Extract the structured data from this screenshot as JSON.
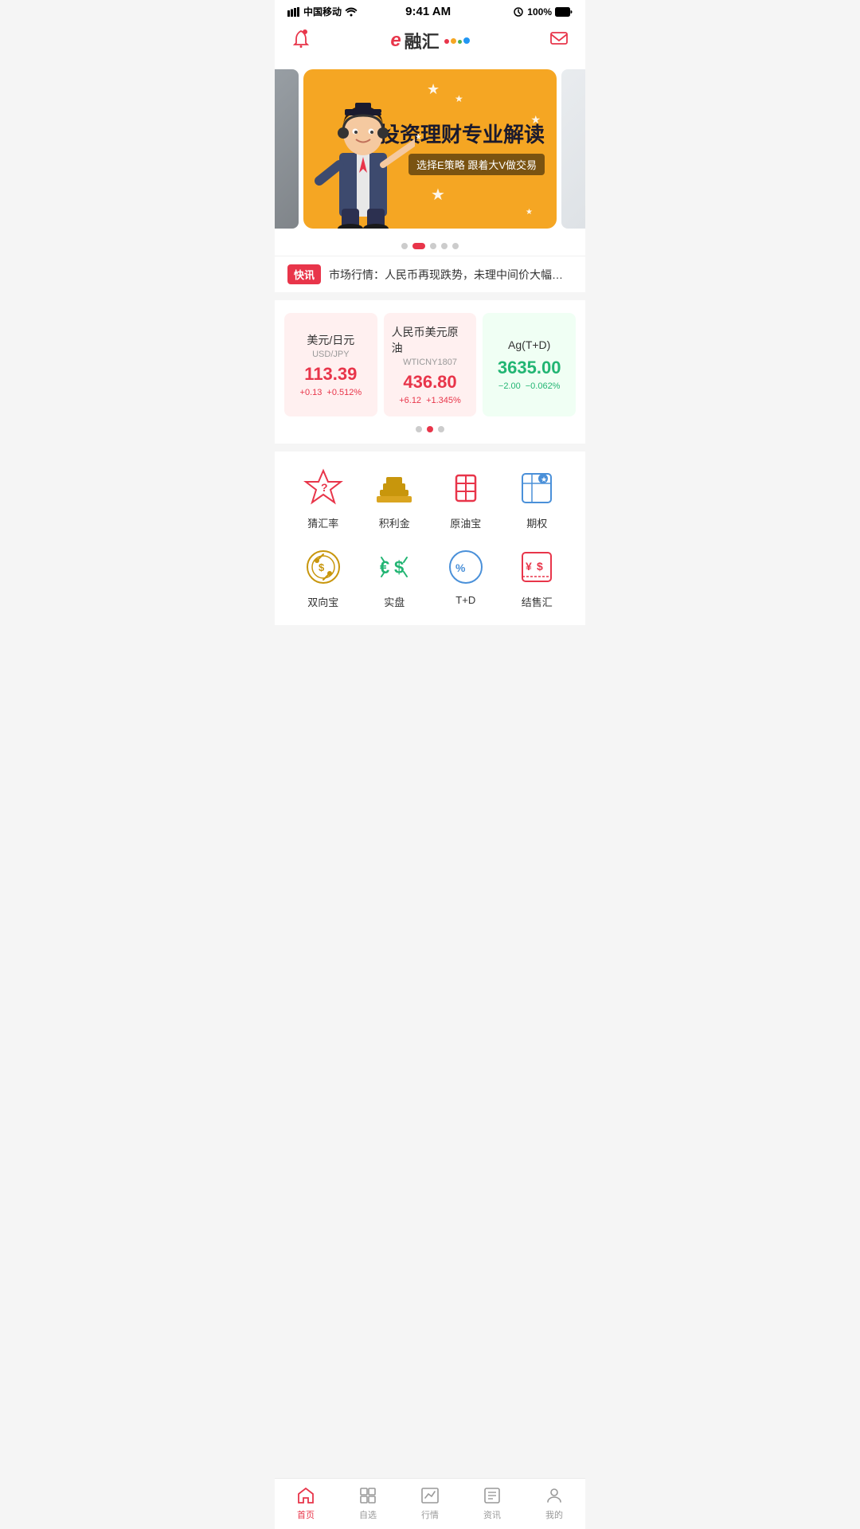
{
  "statusBar": {
    "carrier": "中国移动",
    "time": "9:41 AM",
    "battery": "100%"
  },
  "header": {
    "logoE": "e",
    "logoText": "融汇",
    "dotColors": [
      "#e8354a",
      "#f5a623",
      "#4caf50",
      "#2196f3"
    ]
  },
  "banner": {
    "title": "投资理财专业解读",
    "subtitle": "选择E策略 跟着大V做交易",
    "dots": [
      false,
      true,
      false,
      false,
      false
    ]
  },
  "newsTicker": {
    "badge": "快讯",
    "text": "市场行情：人民币再现跌势，未理中间价大幅上调到..."
  },
  "market": {
    "cards": [
      {
        "name": "美元/日元",
        "code": "USD/JPY",
        "price": "113.39",
        "change1": "+0.13",
        "change2": "+0.512%",
        "type": "up"
      },
      {
        "name": "人民币美元原油",
        "code": "WTICNY1807",
        "price": "436.80",
        "change1": "+6.12",
        "change2": "+1.345%",
        "type": "up"
      },
      {
        "name": "Ag(T+D)",
        "code": "",
        "price": "3635.00",
        "change1": "−2.00",
        "change2": "−0.062%",
        "type": "down"
      }
    ],
    "dots": [
      false,
      true,
      false
    ]
  },
  "menu": {
    "items": [
      {
        "id": "guess-rate",
        "label": "猜汇率",
        "color": "#e8354a"
      },
      {
        "id": "gold",
        "label": "积利金",
        "color": "#c8960c"
      },
      {
        "id": "crude-oil",
        "label": "原油宝",
        "color": "#e8354a"
      },
      {
        "id": "options",
        "label": "期权",
        "color": "#4a90d9"
      },
      {
        "id": "dual",
        "label": "双向宝",
        "color": "#c8960c"
      },
      {
        "id": "live",
        "label": "实盘",
        "color": "#22b573"
      },
      {
        "id": "td",
        "label": "T+D",
        "color": "#4a90d9"
      },
      {
        "id": "exchange",
        "label": "结售汇",
        "color": "#e8354a"
      }
    ]
  },
  "bottomNav": {
    "items": [
      {
        "id": "home",
        "label": "首页",
        "active": true
      },
      {
        "id": "watchlist",
        "label": "自选",
        "active": false
      },
      {
        "id": "market",
        "label": "行情",
        "active": false
      },
      {
        "id": "news",
        "label": "资讯",
        "active": false
      },
      {
        "id": "mine",
        "label": "我的",
        "active": false
      }
    ]
  }
}
